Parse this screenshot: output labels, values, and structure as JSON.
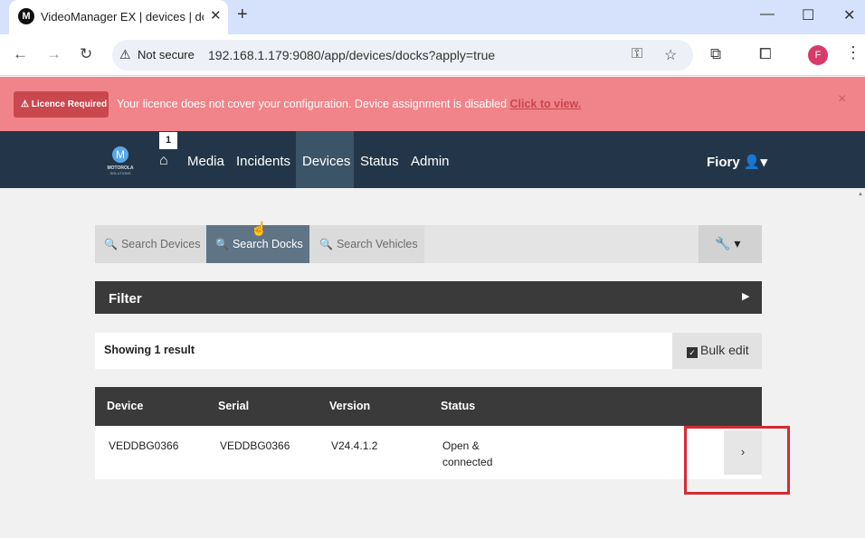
{
  "browser": {
    "tab_title": "VideoManager EX | devices | do",
    "favicon_letter": "M",
    "tab_close": "✕",
    "new_tab": "+",
    "window": {
      "minimize": "—",
      "maximize": "☐",
      "close": "✕"
    },
    "nav": {
      "back": "←",
      "forward": "→",
      "reload": "↻"
    },
    "security_icon": "⚠",
    "security_label": "Not secure",
    "url": "192.168.1.179:9080/app/devices/docks?apply=true",
    "icons": {
      "key": "⚿",
      "star": "☆",
      "extensions": "⧉",
      "cast": "⧠"
    },
    "profile_initial": "F",
    "menu": "⋮"
  },
  "banner": {
    "badge": "⚠ Licence Required",
    "message": "Your licence does not cover your configuration. Device assignment is disabled ",
    "link": "Click to view.",
    "close": "×",
    "colors": {
      "background": "#f0848a",
      "badge": "#c9474e"
    }
  },
  "appnav": {
    "logo_mark": "M",
    "logo_text": "MOTOROLA",
    "logo_subtext": "SOLUTIONS",
    "home_badge": "1",
    "home_icon": "⌂",
    "links": [
      {
        "label": "Media"
      },
      {
        "label": "Incidents"
      },
      {
        "label": "Devices",
        "active": true
      },
      {
        "label": "Status"
      },
      {
        "label": "Admin"
      }
    ],
    "user": "Fiory 👤▾"
  },
  "search_tabs": [
    {
      "icon": "🔍",
      "label": "Search Devices"
    },
    {
      "icon": "🔍",
      "label": "Search Docks",
      "active": true
    },
    {
      "icon": "🔍",
      "label": "Search Vehicles"
    }
  ],
  "tools_button": "🔧 ▾",
  "filter": {
    "title": "Filter",
    "arrow": "▶"
  },
  "results": {
    "summary": "Showing 1 result",
    "bulk_check": "✓",
    "bulk_label": "Bulk edit"
  },
  "table": {
    "columns": [
      "Device",
      "Serial",
      "Version",
      "Status"
    ],
    "rows": [
      {
        "device": "VEDDBG0366",
        "serial": "VEDDBG0366",
        "version": "V24.4.1.2",
        "status_line1": "Open &",
        "status_line2": "connected",
        "action": "›"
      }
    ]
  },
  "scrollbar_up": "▲",
  "cursor": "☝"
}
